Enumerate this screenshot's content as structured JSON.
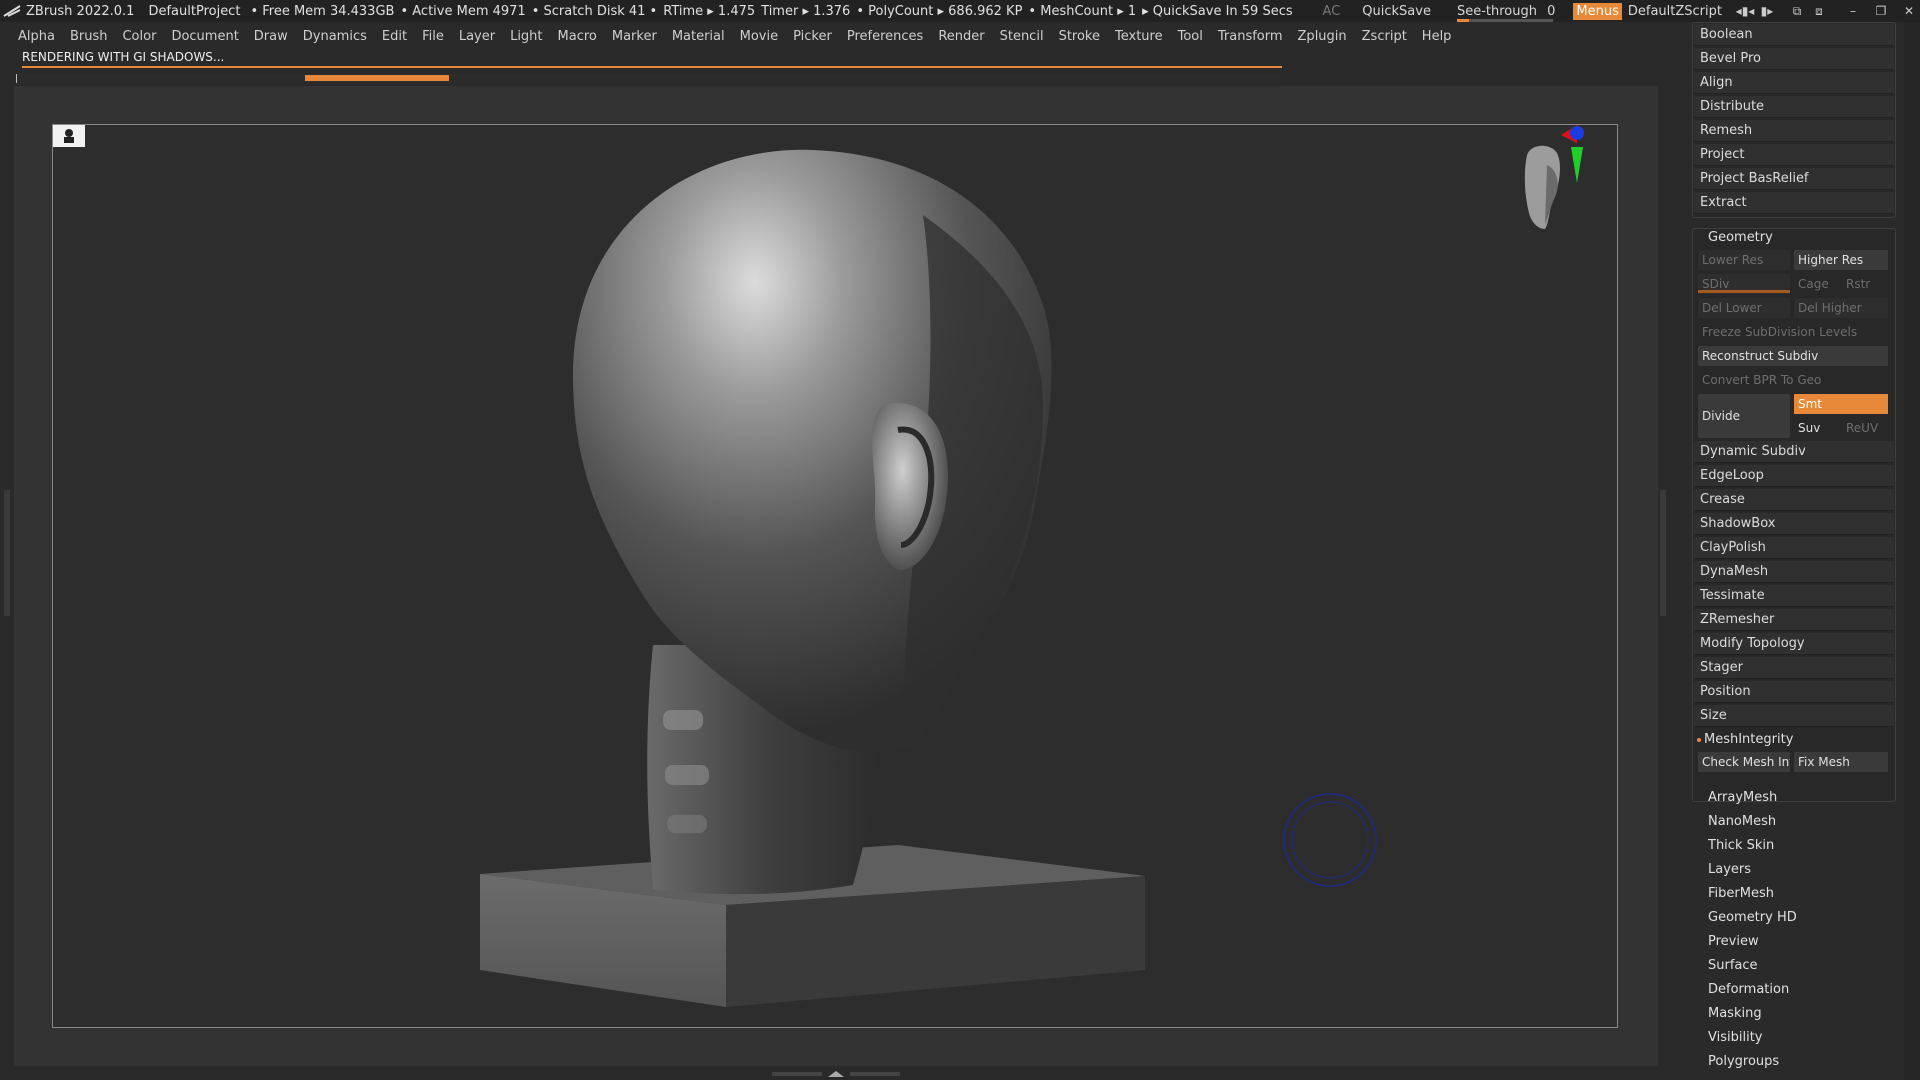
{
  "titlebar": {
    "app": "ZBrush 2022.0.1",
    "project": "DefaultProject",
    "stats": [
      "• Free Mem 34.433GB",
      "• Active Mem 4971",
      "• Scratch Disk 41 •",
      "RTime ▸ 1.475",
      "Timer ▸ 1.376",
      "• PolyCount ▸ 686.962 KP",
      "• MeshCount ▸ 1",
      "▸ QuickSave In 59 Secs"
    ],
    "ac": "AC",
    "quicksave": "QuickSave",
    "see_through": "See-through",
    "see_through_value": "0",
    "menus": "Menus",
    "script": "DefaultZScript"
  },
  "menus": [
    "Alpha",
    "Brush",
    "Color",
    "Document",
    "Draw",
    "Dynamics",
    "Edit",
    "File",
    "Layer",
    "Light",
    "Macro",
    "Marker",
    "Material",
    "Movie",
    "Picker",
    "Preferences",
    "Render",
    "Stencil",
    "Stroke",
    "Texture",
    "Tool",
    "Transform",
    "Zplugin",
    "Zscript",
    "Help"
  ],
  "render_status": "RENDERING WITH GI SHADOWS...",
  "deformation_buttons": [
    "Boolean",
    "Bevel Pro",
    "Align",
    "Distribute",
    "Remesh",
    "Project",
    "Project BasRelief",
    "Extract"
  ],
  "geometry": {
    "title": "Geometry",
    "lower_res": "Lower Res",
    "higher_res": "Higher Res",
    "sdiv": "SDiv",
    "cage": "Cage",
    "rstr": "Rstr",
    "del_lower": "Del Lower",
    "del_higher": "Del Higher",
    "freeze": "Freeze SubDivision Levels",
    "reconstruct": "Reconstruct Subdiv",
    "convert_bpr": "Convert BPR To Geo",
    "divide": "Divide",
    "smt": "Smt",
    "suv": "Suv",
    "reuv": "ReUV",
    "items": [
      "Dynamic Subdiv",
      "EdgeLoop",
      "Crease",
      "ShadowBox",
      "ClayPolish",
      "DynaMesh",
      "Tessimate",
      "ZRemesher",
      "Modify Topology",
      "Stager",
      "Position",
      "Size"
    ],
    "mesh_integrity": "MeshIntegrity",
    "check_mesh": "Check Mesh Integrity",
    "fix_mesh": "Fix Mesh"
  },
  "palettes": [
    "ArrayMesh",
    "NanoMesh",
    "Thick Skin",
    "Layers",
    "FiberMesh",
    "Geometry HD",
    "Preview",
    "Surface",
    "Deformation",
    "Masking",
    "Visibility",
    "Polygroups"
  ],
  "colors": {
    "accent": "#e8893a",
    "panel": "#303030",
    "background": "#2a2a2a"
  }
}
